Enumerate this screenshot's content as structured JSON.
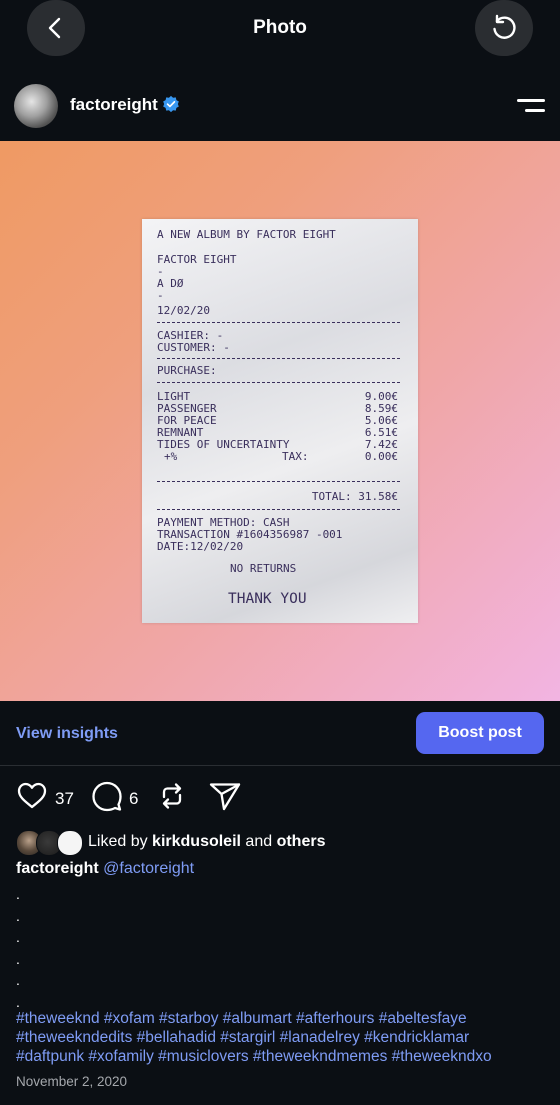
{
  "header": {
    "title": "Photo",
    "back_icon": "chevron-left-icon",
    "refresh_icon": "refresh-icon"
  },
  "profile": {
    "username": "factoreight",
    "verified": true
  },
  "receipt": {
    "line1": "A NEW ALBUM BY FACTOR EIGHT",
    "artist": "FACTOR EIGHT",
    "dash1": "-",
    "label": "A DØ",
    "dash2": "-",
    "date": "12/02/20",
    "cashier": "CASHIER: -",
    "customer": "CUSTOMER: -",
    "purchase": "PURCHASE:",
    "items": [
      {
        "name": "LIGHT",
        "price": "9.00€"
      },
      {
        "name": "PASSENGER",
        "price": "8.59€"
      },
      {
        "name": "FOR PEACE",
        "price": "5.06€"
      },
      {
        "name": "REMNANT",
        "price": "6.51€"
      },
      {
        "name": "TIDES OF UNCERTAINTY",
        "price": "7.42€"
      }
    ],
    "tax_pct": "+%",
    "tax_label": "TAX:",
    "tax_value": "0.00€",
    "total": "TOTAL: 31.58€",
    "payment": "PAYMENT METHOD: CASH",
    "transaction": "TRANSACTION #1604356987 -001",
    "date_line": "DATE:12/02/20",
    "no_returns": "NO RETURNS",
    "thanks": "THANK YOU"
  },
  "actions": {
    "insights": "View insights",
    "boost": "Boost post"
  },
  "engagement": {
    "likes": "37",
    "comments": "6"
  },
  "liked_by": {
    "prefix": "Liked by",
    "user": "kirkdusoleil",
    "and": "and",
    "others": "others"
  },
  "caption": {
    "username": "factoreight",
    "mention": "@factoreight"
  },
  "hashtags": [
    "#theweeknd #xofam #starboy #albumart #afterhours #abeltesfaye",
    "#theweekndedits #bellahadid #stargirl #lanadelrey #kendricklamar",
    "#daftpunk #xofamily #musiclovers #theweekndmemes #theweekndxo"
  ],
  "post_date": "November 2, 2020",
  "colors": {
    "accent": "#5567f0",
    "link": "#7f9cf5",
    "verified": "#3897f0",
    "background": "#0b0f14"
  }
}
